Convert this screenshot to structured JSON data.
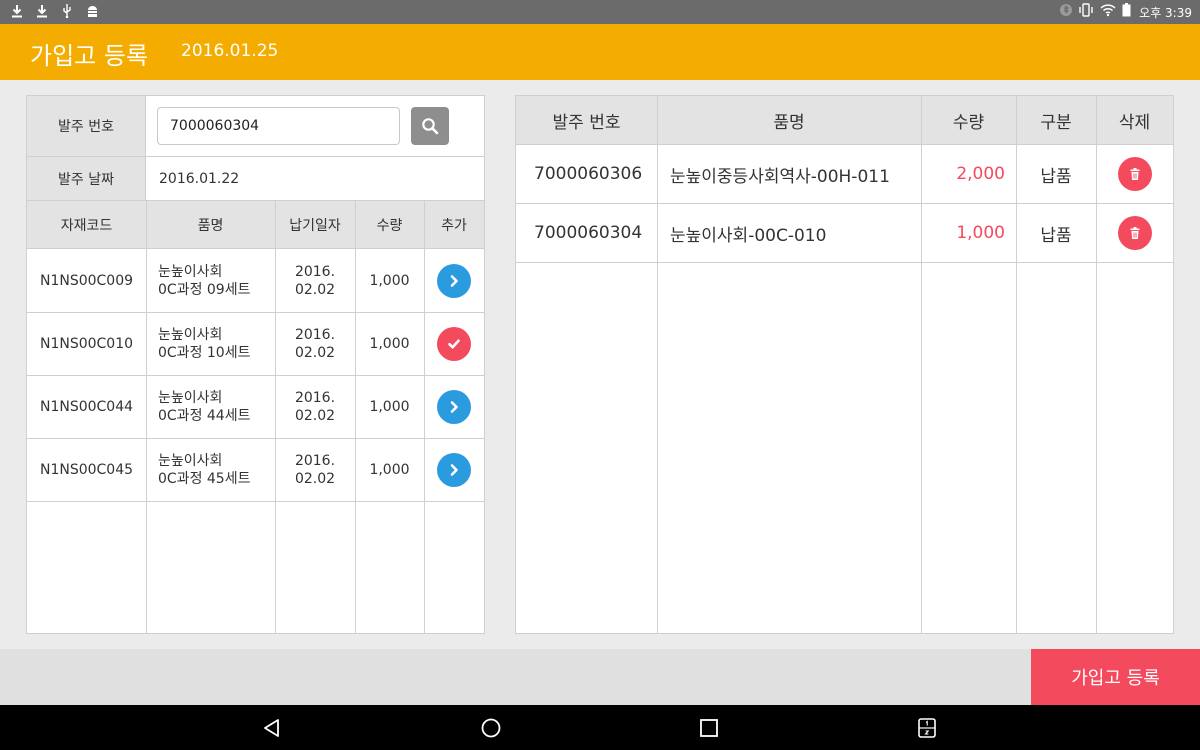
{
  "status_bar": {
    "left_icons": [
      "download-icon",
      "download-icon",
      "usb-icon",
      "android-debug-icon"
    ],
    "right_icons": [
      "bluetooth-icon",
      "vibrate-icon",
      "wifi-icon",
      "battery-icon"
    ],
    "time": "오후 3:39"
  },
  "app_bar": {
    "title": "가입고 등록",
    "date": "2016.01.25",
    "color": "#f5ac00"
  },
  "left_form": {
    "po_number_label": "발주 번호",
    "po_number_value": "7000060304",
    "search_icon": "search-icon",
    "po_date_label": "발주 날짜",
    "po_date_value": "2016.01.22"
  },
  "left_table": {
    "headers": [
      "자재코드",
      "품명",
      "납기일자",
      "수량",
      "추가"
    ],
    "rows": [
      {
        "code": "N1NS00C009",
        "name_line1": "눈높이사회",
        "name_line2": "0C과정 09세트",
        "due_line1": "2016.",
        "due_line2": "02.02",
        "qty": "1,000",
        "action": "add",
        "action_icon": "chevron-right-icon"
      },
      {
        "code": "N1NS00C010",
        "name_line1": "눈높이사회",
        "name_line2": "0C과정 10세트",
        "due_line1": "2016.",
        "due_line2": "02.02",
        "qty": "1,000",
        "action": "added",
        "action_icon": "check-icon"
      },
      {
        "code": "N1NS00C044",
        "name_line1": "눈높이사회",
        "name_line2": "0C과정 44세트",
        "due_line1": "2016.",
        "due_line2": "02.02",
        "qty": "1,000",
        "action": "add",
        "action_icon": "chevron-right-icon"
      },
      {
        "code": "N1NS00C045",
        "name_line1": "눈높이사회",
        "name_line2": "0C과정 45세트",
        "due_line1": "2016.",
        "due_line2": "02.02",
        "qty": "1,000",
        "action": "add",
        "action_icon": "chevron-right-icon"
      }
    ]
  },
  "right_table": {
    "headers": [
      "발주 번호",
      "품명",
      "수량",
      "구분",
      "삭제"
    ],
    "rows": [
      {
        "po": "7000060306",
        "name": "눈높이중등사회역사-00H-011",
        "qty": "2,000",
        "type": "납품",
        "delete_icon": "trash-icon"
      },
      {
        "po": "7000060304",
        "name": "눈높이사회-00C-010",
        "qty": "1,000",
        "type": "납품",
        "delete_icon": "trash-icon"
      }
    ]
  },
  "bottom": {
    "submit_label": "가입고 등록",
    "submit_color": "#f44a5e"
  },
  "colors": {
    "add_button": "#2b9be0",
    "added_button": "#f44a5e",
    "qty_red": "#f44a5e"
  },
  "nav_bar": {
    "icons": [
      "back-icon",
      "home-icon",
      "recents-icon",
      "multi-window-icon"
    ]
  }
}
